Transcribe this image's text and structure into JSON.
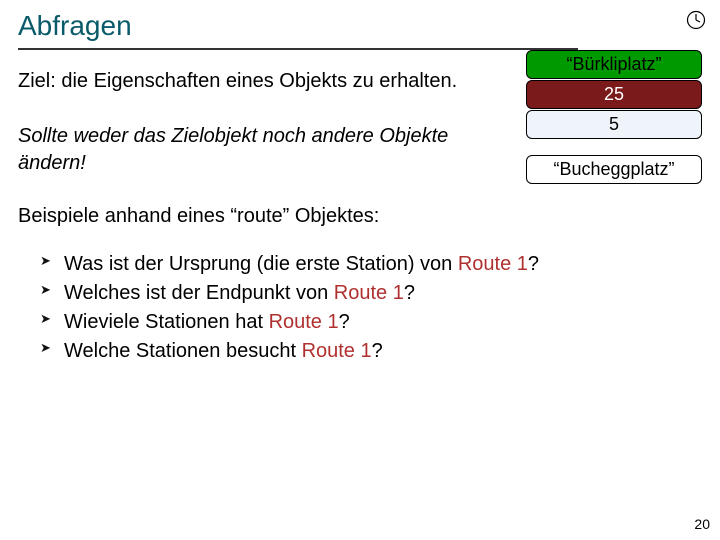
{
  "slide": {
    "title": "Abfragen",
    "lead": "Ziel: die Eigenschaften eines Objekts zu erhalten.",
    "lead2": "Sollte weder das Zielobjekt noch andere Objekte ändern!",
    "examples_lead": "Beispiele anhand eines “route” Objektes:",
    "page_number": "20"
  },
  "boxes": {
    "items": [
      "“Bürkliplatz”",
      "25",
      "5",
      "“Bucheggplatz”"
    ]
  },
  "bullets": {
    "b1_pre": "Was ist der Ursprung (die erste Station) von ",
    "b1_route": "Route 1",
    "b1_post": "?",
    "b2_pre": "Welches ist der Endpunkt von ",
    "b2_route": "Route 1",
    "b2_post": "?",
    "b3_pre": "Wieviele Stationen hat ",
    "b3_route": "Route 1",
    "b3_post": "?",
    "b4_pre": "Welche Stationen besucht ",
    "b4_route": "Route 1",
    "b4_post": "?"
  }
}
